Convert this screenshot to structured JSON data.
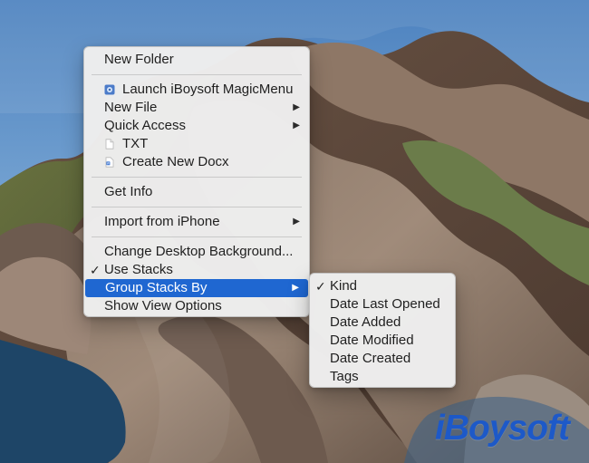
{
  "menu": {
    "new_folder": "New Folder",
    "launch_magicmenu": "Launch iBoysoft MagicMenu",
    "new_file": "New File",
    "quick_access": "Quick Access",
    "txt": "TXT",
    "create_docx": "Create New Docx",
    "get_info": "Get Info",
    "import_iphone": "Import from iPhone",
    "change_background": "Change Desktop Background...",
    "use_stacks": "Use Stacks",
    "group_stacks_by": "Group Stacks By",
    "show_view_options": "Show View Options",
    "check_symbol": "✓",
    "arrow_symbol": "▶"
  },
  "submenu": {
    "kind": "Kind",
    "date_last_opened": "Date Last Opened",
    "date_added": "Date Added",
    "date_modified": "Date Modified",
    "date_created": "Date Created",
    "tags": "Tags",
    "check_symbol": "✓"
  },
  "branding": {
    "watermark": "iBoysoft"
  },
  "colors": {
    "highlight": "#1f67d1",
    "menu_background": "#eeeeee",
    "watermark": "#1d59c8"
  },
  "icons": {
    "launch_icon": "magic-menu-icon",
    "txt_icon": "document-icon",
    "docx_icon": "word-document-icon",
    "arrow_icon": "chevron-right-icon",
    "check_icon": "checkmark-icon"
  }
}
